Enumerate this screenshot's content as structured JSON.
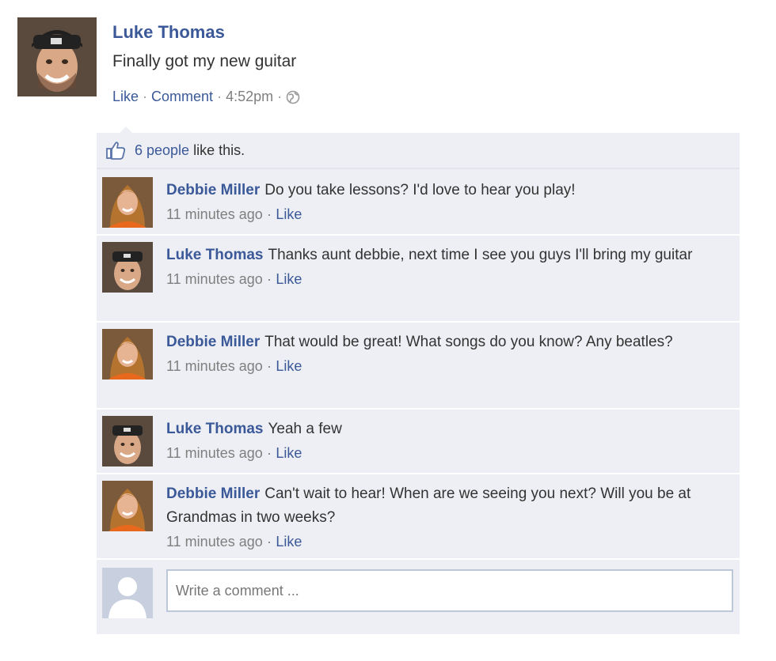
{
  "post": {
    "author": "Luke Thomas",
    "text": "Finally got my new guitar",
    "like_label": "Like",
    "comment_label": "Comment",
    "time": "4:52pm",
    "separator": "·"
  },
  "likes": {
    "count_label": "6 people",
    "suffix": "like this."
  },
  "comments": [
    {
      "author": "Debbie Miller",
      "text": "Do you take lessons? I'd love to hear you play!",
      "time": "11 minutes ago",
      "like_label": "Like"
    },
    {
      "author": "Luke Thomas",
      "text": "Thanks aunt debbie, next time I see you guys I'll bring my guitar",
      "time": "11 minutes ago",
      "like_label": "Like"
    },
    {
      "author": "Debbie Miller",
      "text": "That would be great! What songs do you know? Any beatles?",
      "time": "11 minutes ago",
      "like_label": "Like"
    },
    {
      "author": "Luke Thomas",
      "text": "Yeah a few",
      "time": "11 minutes ago",
      "like_label": "Like"
    },
    {
      "author": "Debbie Miller",
      "text": "Can't wait to hear! When are we seeing you next? Will you be at Grandmas in two weeks?",
      "time": "11 minutes ago",
      "like_label": "Like"
    }
  ],
  "composer": {
    "placeholder": "Write a comment ..."
  },
  "colors": {
    "link": "#3b5998",
    "panel": "#edeff4"
  }
}
